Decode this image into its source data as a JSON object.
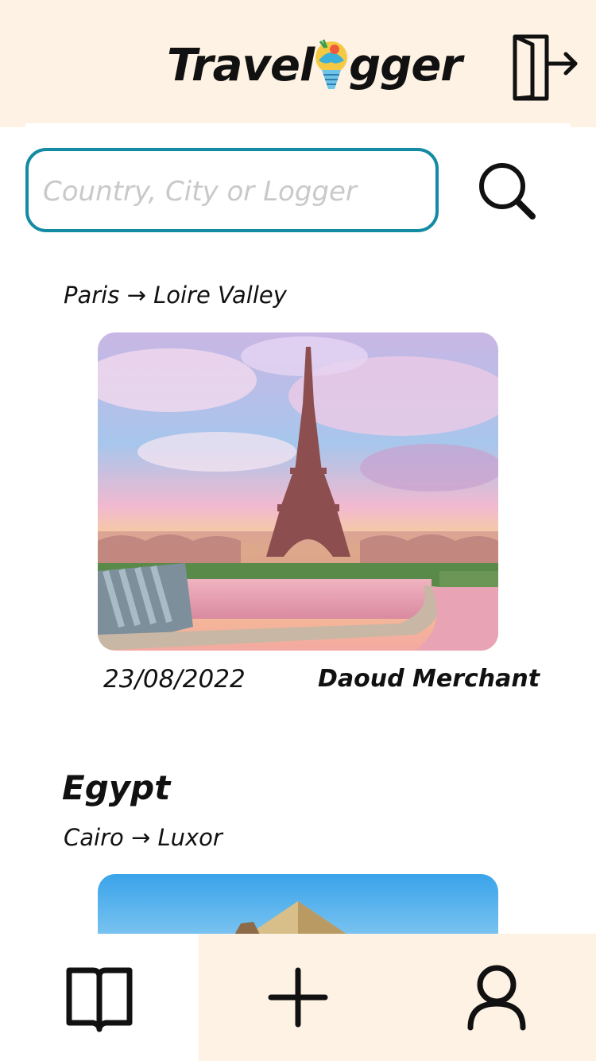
{
  "header": {
    "logo_text_left": "Travel",
    "logo_text_right": "gger",
    "logout_icon": "logout-icon"
  },
  "search": {
    "placeholder": "Country, City or Logger",
    "button_icon": "search-icon",
    "border_color": "#138ba3"
  },
  "feed": [
    {
      "country": "",
      "route": "Paris → Loire Valley",
      "photo": "eiffel-tower-photo",
      "date": "23/08/2022",
      "author": "Daoud Merchant"
    },
    {
      "country": "Egypt",
      "route": "Cairo → Luxor",
      "photo": "pyramids-photo"
    }
  ],
  "bottom_nav": {
    "items": [
      {
        "icon": "book-icon"
      },
      {
        "icon": "plus-icon"
      },
      {
        "icon": "user-icon"
      }
    ]
  },
  "colors": {
    "header_bg": "#fdf2e3",
    "accent": "#138ba3"
  }
}
